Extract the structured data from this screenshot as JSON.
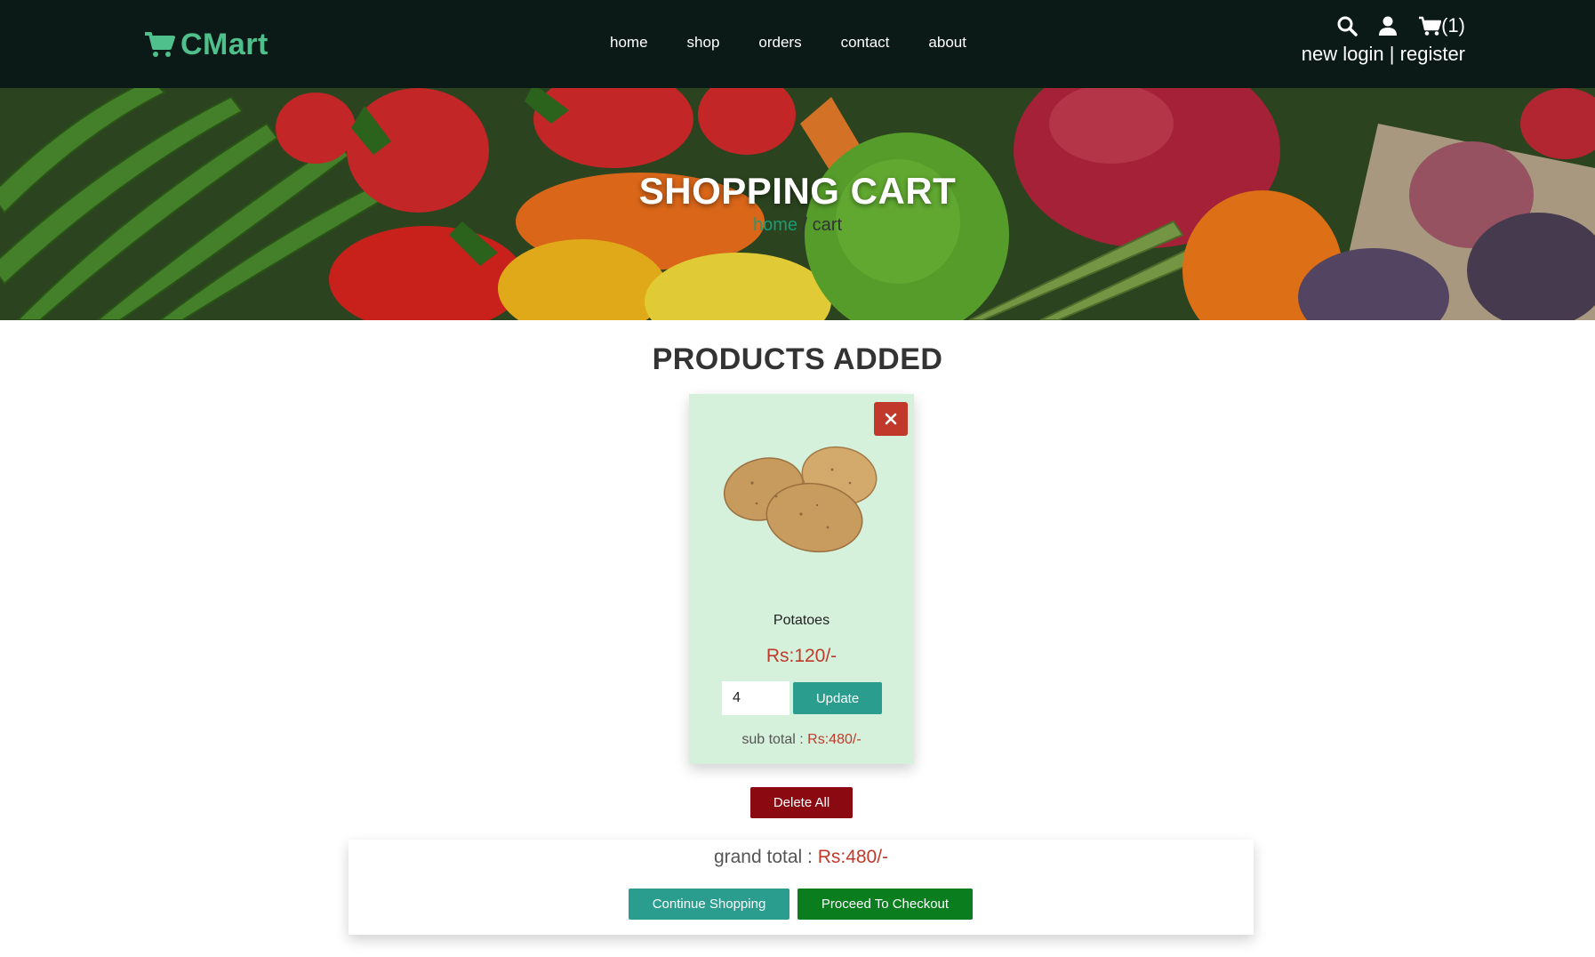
{
  "header": {
    "logo_text": "CMart",
    "nav": [
      {
        "label": "home"
      },
      {
        "label": "shop"
      },
      {
        "label": "orders"
      },
      {
        "label": "contact"
      },
      {
        "label": "about"
      }
    ],
    "cart_count": "(1)",
    "auth_new_login": "new login",
    "auth_separator": "|",
    "auth_register": "register",
    "icons": [
      "search-icon",
      "user-icon",
      "cart-icon"
    ]
  },
  "hero": {
    "title": "SHOPPING CART",
    "breadcrumb_home": "home",
    "breadcrumb_sep": " / ",
    "breadcrumb_current": "cart"
  },
  "section": {
    "title": "PRODUCTS ADDED"
  },
  "cart_items": [
    {
      "name": "Potatoes",
      "price": "Rs:120/-",
      "quantity": "4",
      "update_label": "Update",
      "subtotal_label": "sub total : ",
      "subtotal_value": "Rs:480/-",
      "remove_icon": "close-icon"
    }
  ],
  "actions": {
    "delete_all_label": "Delete All",
    "grand_total_label": "grand total : ",
    "grand_total_value": "Rs:480/-",
    "continue_label": "Continue Shopping",
    "checkout_label": "Proceed To Checkout"
  },
  "colors": {
    "header_bg": "#0c1a17",
    "brand_green": "#4fbf8b",
    "card_bg": "#d5f1dc",
    "price_red": "#c0392b",
    "teal_button": "#2a9d8f",
    "checkout_green": "#0a7d1e",
    "delete_red": "#8b0a12"
  }
}
